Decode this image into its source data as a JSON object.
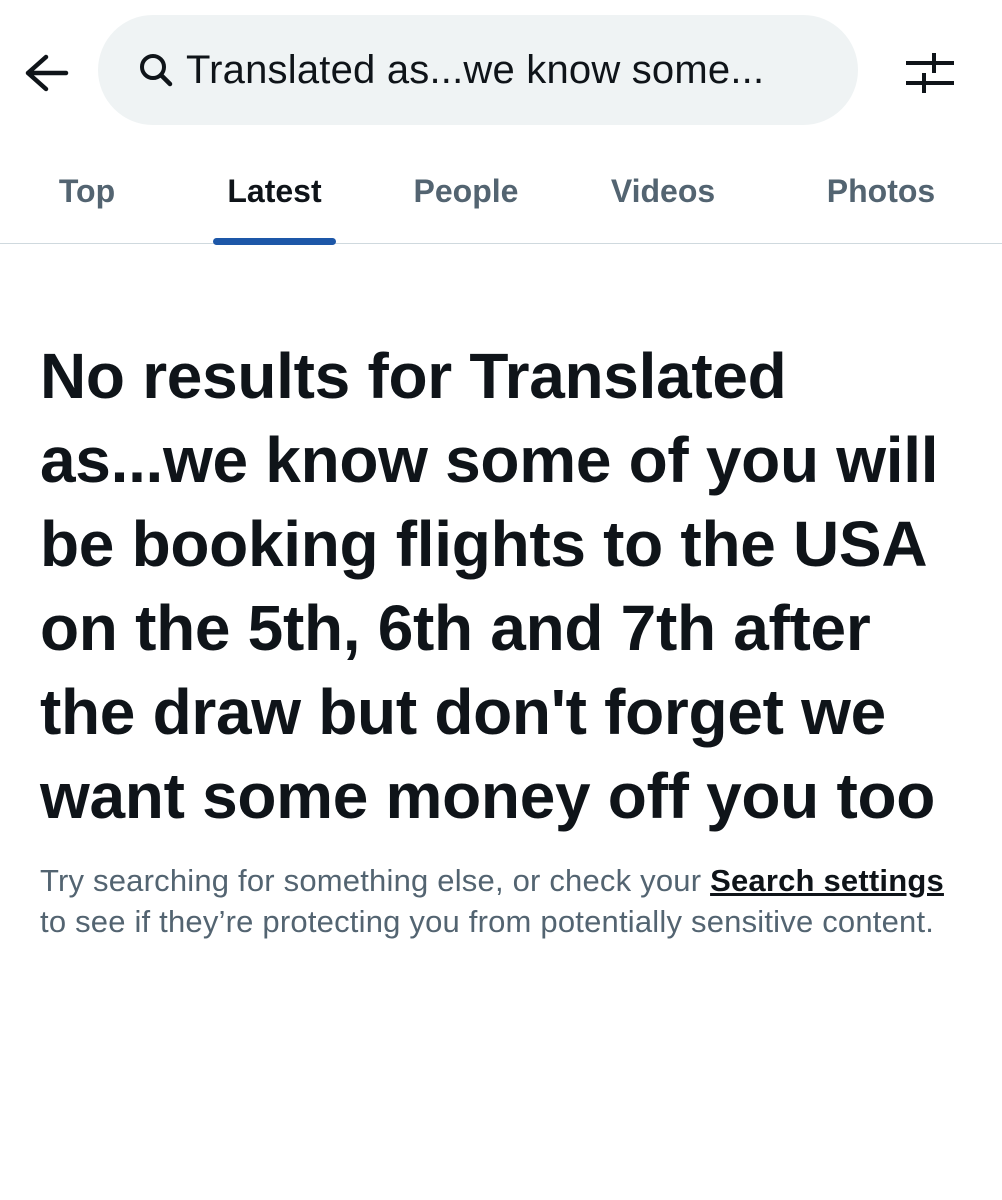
{
  "header": {
    "back_icon": "arrow-left-icon",
    "search": {
      "icon": "search-icon",
      "query": "Translated as...we know some..."
    },
    "filter_icon": "sliders-icon"
  },
  "tabs": [
    {
      "label": "Top",
      "active": false
    },
    {
      "label": "Latest",
      "active": true
    },
    {
      "label": "People",
      "active": false
    },
    {
      "label": "Videos",
      "active": false
    },
    {
      "label": "Photos",
      "active": false
    }
  ],
  "empty_state": {
    "title": "No results for Translated as...we know some of you will be booking flights to the USA on the 5th, 6th and 7th after the draw but don't forget we want some money off you too",
    "desc_before": "Try searching for something else, or check your ",
    "link_text": "Search settings",
    "desc_after": " to see if they’re protecting you from potentially sensitive content."
  },
  "colors": {
    "accent": "#1d57a8",
    "text_primary": "#0f1419",
    "text_secondary": "#536471",
    "search_bg": "#eff3f4",
    "divider": "#cfd9de"
  }
}
